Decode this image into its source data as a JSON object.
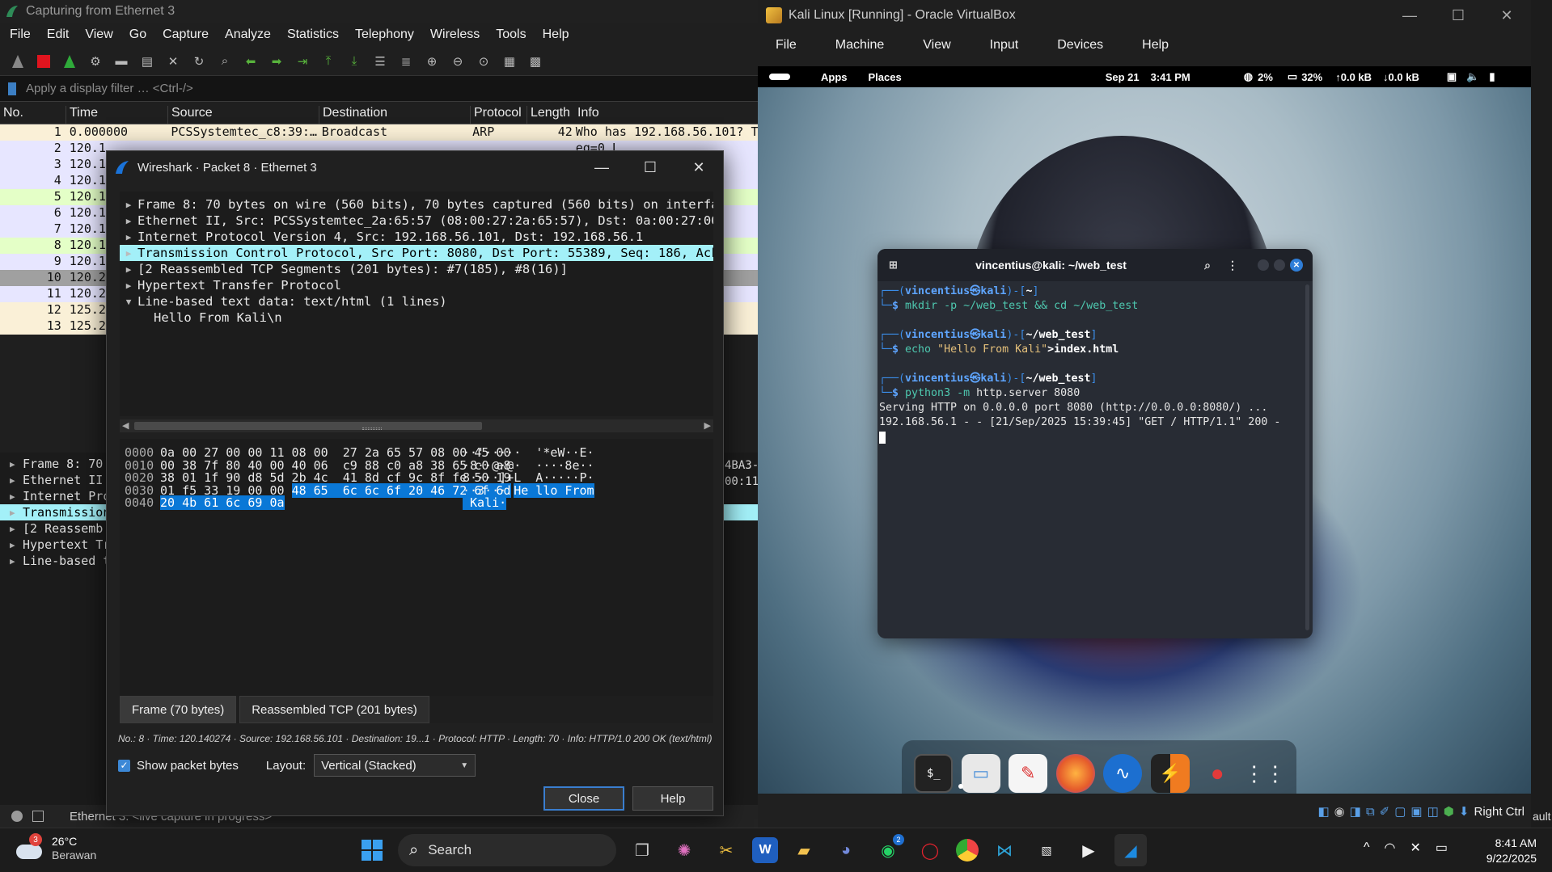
{
  "wireshark": {
    "title": "Capturing from Ethernet 3",
    "menu": [
      "File",
      "Edit",
      "View",
      "Go",
      "Capture",
      "Analyze",
      "Statistics",
      "Telephony",
      "Wireless",
      "Tools",
      "Help"
    ],
    "filter_placeholder": "Apply a display filter … <Ctrl-/>",
    "columns": [
      "No.",
      "Time",
      "Source",
      "Destination",
      "Protocol",
      "Length",
      "Info"
    ],
    "packets": [
      {
        "no": "1",
        "time": "0.000000",
        "src": "PCSSystemtec_c8:39:…",
        "dst": "Broadcast",
        "proto": "ARP",
        "len": "42",
        "info": "Who has 192.168.56.101? Te",
        "color": "#faf0d7"
      },
      {
        "no": "2",
        "time": "120.1",
        "src": "",
        "dst": "",
        "proto": "",
        "len": "",
        "info": "eq=0 L",
        "color": "#e7e6ff"
      },
      {
        "no": "3",
        "time": "120.1",
        "src": "",
        "dst": "",
        "proto": "",
        "len": "",
        "info": "K] Se",
        "color": "#e7e6ff"
      },
      {
        "no": "4",
        "time": "120.1",
        "src": "",
        "dst": "",
        "proto": "",
        "len": "",
        "info": "q=1 A",
        "color": "#e7e6ff"
      },
      {
        "no": "5",
        "time": "120.1",
        "src": "",
        "dst": "",
        "proto": "",
        "len": "",
        "info": "",
        "color": "#e4ffc7"
      },
      {
        "no": "6",
        "time": "120.1",
        "src": "",
        "dst": "",
        "proto": "",
        "len": "",
        "info": "q=1 A",
        "color": "#e7e6ff"
      },
      {
        "no": "7",
        "time": "120.1",
        "src": "",
        "dst": "",
        "proto": "",
        "len": "",
        "info": "K] Se",
        "color": "#e7e6ff"
      },
      {
        "no": "8",
        "time": "120.1",
        "src": "",
        "dst": "",
        "proto": "",
        "len": "",
        "info": "t/htm",
        "color": "#e4ffc7"
      },
      {
        "no": "9",
        "time": "120.1",
        "src": "",
        "dst": "",
        "proto": "",
        "len": "",
        "info": "q=165",
        "color": "#e7e6ff"
      },
      {
        "no": "10",
        "time": "120.2",
        "src": "",
        "dst": "",
        "proto": "",
        "len": "",
        "info": "K] Se",
        "color": "#a0a0a0"
      },
      {
        "no": "11",
        "time": "120.2",
        "src": "",
        "dst": "",
        "proto": "",
        "len": "",
        "info": "q=201",
        "color": "#e7e6ff"
      },
      {
        "no": "12",
        "time": "125.2",
        "src": "",
        "dst": "",
        "proto": "",
        "len": "",
        "info": "Tell",
        "color": "#faf0d7"
      },
      {
        "no": "13",
        "time": "125.2",
        "src": "",
        "dst": "",
        "proto": "",
        "len": "",
        "info": ":00:3",
        "color": "#faf0d7"
      }
    ],
    "lower_tree": [
      "Frame 8: 70",
      "Ethernet II",
      "Internet Pro",
      "Transmission",
      "[2 Reassemb",
      "Hypertext Tr",
      "Line-based t"
    ],
    "lower_right": [
      "4BA3-",
      "00:11"
    ],
    "status_text": "Ethernet 3: <live capture in progress>"
  },
  "dialog": {
    "title": "Wireshark · Packet 8 · Ethernet 3",
    "tree": [
      {
        "text": "Frame 8: 70 bytes on wire (560 bits), 70 bytes captured (560 bits) on interface",
        "arrow": "▶",
        "indent": 0
      },
      {
        "text": "Ethernet II, Src: PCSSystemtec_2a:65:57 (08:00:27:2a:65:57), Dst: 0a:00:27:00:0",
        "arrow": "▶",
        "indent": 0
      },
      {
        "text": "Internet Protocol Version 4, Src: 192.168.56.101, Dst: 192.168.56.1",
        "arrow": "▶",
        "indent": 0
      },
      {
        "text": "Transmission Control Protocol, Src Port: 8080, Dst Port: 55389, Seq: 186, Ack:",
        "arrow": "▶",
        "indent": 0,
        "selected": true
      },
      {
        "text": "[2 Reassembled TCP Segments (201 bytes): #7(185), #8(16)]",
        "arrow": "▶",
        "indent": 0
      },
      {
        "text": "Hypertext Transfer Protocol",
        "arrow": "▶",
        "indent": 0
      },
      {
        "text": "Line-based text data: text/html (1 lines)",
        "arrow": "▼",
        "indent": 0
      },
      {
        "text": "Hello From Kali\\n",
        "arrow": "",
        "indent": 1
      }
    ],
    "hex": {
      "offsets": [
        "0000",
        "0010",
        "0020",
        "0030",
        "0040"
      ],
      "rows": [
        {
          "a": "0a 00 27 00 00 11 08 00  27 2a 65 57 08 00 45 00",
          "hl": "",
          "ascii": "··'·····  '*eW··E·",
          "asciihl": ""
        },
        {
          "a": "00 38 7f 80 40 00 40 06  c9 88 c0 a8 38 65 c0 a8",
          "hl": "",
          "ascii": "·8··@·@·  ····8e··",
          "asciihl": ""
        },
        {
          "a": "38 01 1f 90 d8 5d 2b 4c  41 8d cf 9c 8f fe 50 19",
          "hl": "",
          "ascii": "8····]+L  A·····P·",
          "asciihl": ""
        },
        {
          "a": "01 f5 33 19 00 00 ",
          "hl": "48 65  6c 6c 6f 20 46 72 6f 6d",
          "ascii": "··3··· ",
          "asciihl": "He llo From"
        },
        {
          "a": "",
          "hl": "20 4b 61 6c 69 0a",
          "ascii": "",
          "asciihl": " Kali·"
        }
      ]
    },
    "tabs": [
      "Frame (70 bytes)",
      "Reassembled TCP (201 bytes)"
    ],
    "info": "No.: 8 · Time: 120.140274 · Source: 192.168.56.101 · Destination: 19...1 · Protocol: HTTP · Length: 70 · Info: HTTP/1.0 200 OK (text/html)",
    "show_bytes_label": "Show packet bytes",
    "layout_label": "Layout:",
    "layout_value": "Vertical (Stacked)",
    "close_label": "Close",
    "help_label": "Help"
  },
  "virtualbox": {
    "title": "Kali Linux  [Running] - Oracle VirtualBox",
    "menu": [
      "File",
      "Machine",
      "View",
      "Input",
      "Devices",
      "Help"
    ],
    "kali_bar": {
      "apps": "Apps",
      "places": "Places",
      "date": "Sep 21",
      "time": "3:41 PM",
      "cpu": "2%",
      "mem": "32%",
      "up": "0.0 kB",
      "down": "0.0 kB"
    },
    "status_key": "Right Ctrl",
    "status_right": "ault"
  },
  "terminal": {
    "title": "vincentius@kali: ~/web_test",
    "lines": [
      {
        "type": "prompt",
        "user": "vincentius",
        "host": "kali",
        "dir": "~"
      },
      {
        "type": "cmd",
        "parts": [
          {
            "c": "cmd",
            "t": "mkdir -p ~/web_test "
          },
          {
            "c": "cmd",
            "t": "&& "
          },
          {
            "c": "cmd",
            "t": "cd ~/web_test"
          }
        ]
      },
      {
        "type": "blank"
      },
      {
        "type": "prompt",
        "user": "vincentius",
        "host": "kali",
        "dir": "~/web_test"
      },
      {
        "type": "cmd",
        "parts": [
          {
            "c": "cmd",
            "t": "echo "
          },
          {
            "c": "str",
            "t": "\"Hello From Kali\""
          },
          {
            "c": "pw",
            "t": ">index.html"
          }
        ]
      },
      {
        "type": "blank"
      },
      {
        "type": "prompt",
        "user": "vincentius",
        "host": "kali",
        "dir": "~/web_test"
      },
      {
        "type": "cmd",
        "parts": [
          {
            "c": "cmd",
            "t": "python3 "
          },
          {
            "c": "cmd",
            "t": "-m "
          },
          {
            "c": "plain",
            "t": "http.server 8080"
          }
        ]
      },
      {
        "type": "out",
        "text": "Serving HTTP on 0.0.0.0 port 8080 (http://0.0.0.0:8080/) ..."
      },
      {
        "type": "out",
        "text": "192.168.56.1 - - [21/Sep/2025 15:39:45] \"GET / HTTP/1.1\" 200 -"
      }
    ]
  },
  "dock_icons": [
    "terminal-icon",
    "files-icon",
    "text-editor-icon",
    "firefox-icon",
    "wireshark-icon",
    "burpsuite-icon",
    "cherrytree-icon",
    "app-grid-icon"
  ],
  "taskbar": {
    "weather_temp": "26°C",
    "weather_desc": "Berawan",
    "weather_badge": "3",
    "search_label": "Search",
    "whatsapp_badge": "2",
    "time": "8:41 AM",
    "date": "9/22/2025"
  }
}
